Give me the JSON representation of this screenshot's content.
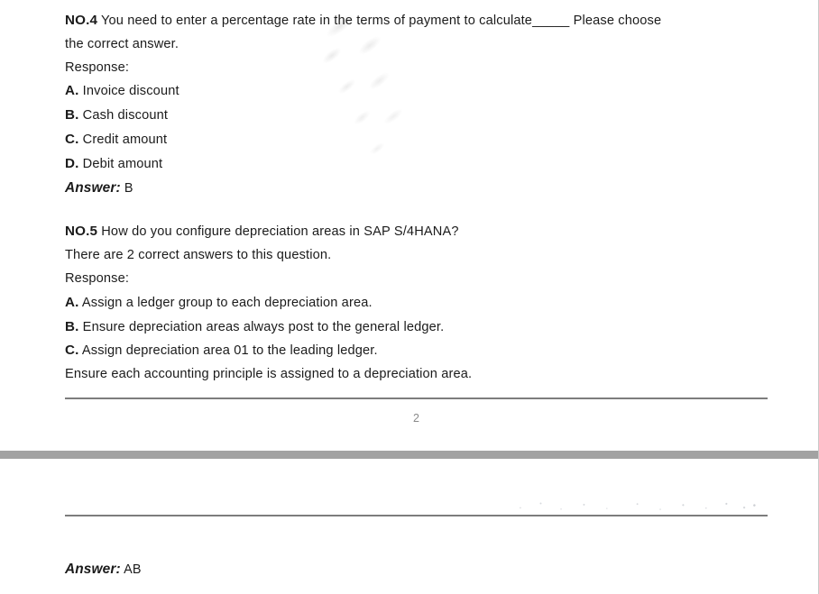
{
  "document": {
    "page_one": {
      "questions": [
        {
          "number": "NO.4",
          "stem": " You need to enter a percentage rate in the terms of payment to calculate_____ Please choose",
          "stem_continuation": "the correct answer.",
          "response_label": "Response:",
          "options": [
            {
              "letter": "A.",
              "text": " Invoice discount"
            },
            {
              "letter": "B.",
              "text": " Cash discount"
            },
            {
              "letter": "C.",
              "text": " Credit amount"
            },
            {
              "letter": "D.",
              "text": " Debit amount"
            }
          ],
          "answer_label": "Answer:",
          "answer_value": " B"
        },
        {
          "number": "NO.5",
          "stem": " How do you configure depreciation areas in SAP S/4HANA?",
          "stem_continuation": "There are 2 correct answers to this question.",
          "response_label": "Response:",
          "options": [
            {
              "letter": "A.",
              "text": " Assign a ledger group to each depreciation area."
            },
            {
              "letter": "B.",
              "text": " Ensure depreciation areas always post to the general ledger."
            },
            {
              "letter": "C.",
              "text": " Assign depreciation area 01 to the leading ledger."
            }
          ],
          "trailing_line": "Ensure each accounting principle is assigned to a depreciation area."
        }
      ],
      "page_number": "2"
    },
    "page_two": {
      "answer_label": "Answer:",
      "answer_value": " AB"
    }
  },
  "colors": {
    "text": "#1b1b1b",
    "rule": "#7d7d7d",
    "page_break_band": "#a2a2a2",
    "page_number": "#8a8a8a"
  }
}
